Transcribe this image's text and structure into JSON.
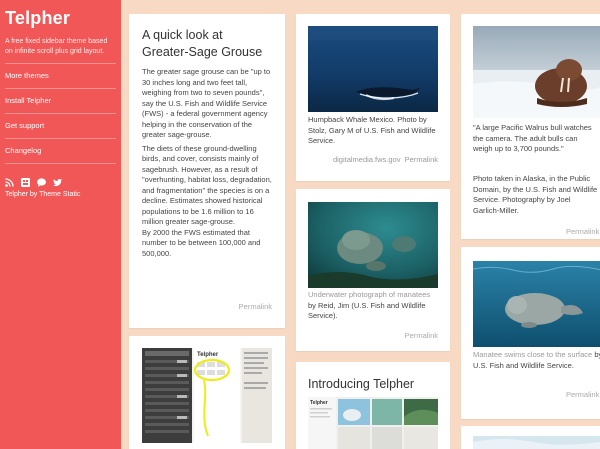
{
  "sidebar": {
    "title": "Telpher",
    "description": "A free fixed sidebar theme based on infinite scroll plus grid layout.",
    "links": [
      {
        "label": "More themes"
      },
      {
        "label": "Install Telpher"
      },
      {
        "label": "Get support"
      },
      {
        "label": "Changelog"
      }
    ],
    "social_icons": [
      "rss-icon",
      "grid-icon",
      "chat-icon",
      "twitter-icon"
    ],
    "credit": "Telpher by Theme Static"
  },
  "posts": {
    "grouse": {
      "title": "A quick look at Greater-Sage Grouse",
      "para1": "The greater sage grouse can be \"up to 30 inches long and two feet tall, weighing from two to seven pounds\", say the U.S. Fish and Wildlife Service (FWS) - a federal government agency helping in the conservation of the greater sage-grouse.",
      "para2": "The diets of these ground-dwelling birds, and cover, consists mainly of sagebrush. However, as a result of \"overhunting, habitat loss, degradation, and fragmentation\" the species is on a decline. Estimates showed historical populations to be 1.6 million to 16 million greater sage-grouse.",
      "para3": "By 2000 the FWS estimated that number to be between 100,000 and 500,000.",
      "permalink": "Permalink"
    },
    "whale": {
      "caption": "Humpback Whale Mexico. Photo by Stolz, Gary M of U.S. Fish and Wildlife Service.",
      "source": "digitalmedia.fws.gov",
      "permalink": "Permalink"
    },
    "walrus": {
      "quote": "\"A large Pacific Walrus bull watches the camera. The adult bulls can weigh up to 3,700 pounds.\"",
      "caption": "Photo taken in Alaska, in the Public Domain, by the U.S. Fish and Wildlife Service. Photography by Joel Garlich-Miller.",
      "permalink": "Permalink"
    },
    "manatee1": {
      "caption_muted": "Underwater photograph of manatees",
      "caption_rest": " by Reid, Jim (U.S. Fish and Wildlife Service).",
      "permalink": "Permalink"
    },
    "manatee2": {
      "caption_muted": "Manatee swims close to the surface",
      "caption_rest": " by U.S. Fish and Wildlife Service.",
      "permalink": "Permalink"
    },
    "introducing": {
      "title": "Introducing Telpher",
      "thumb_label": "Telpher"
    },
    "screenshot": {
      "label": "Telpher"
    }
  },
  "colors": {
    "sidebar": "#f25757",
    "background": "#f7d9c4",
    "card": "#ffffff"
  }
}
